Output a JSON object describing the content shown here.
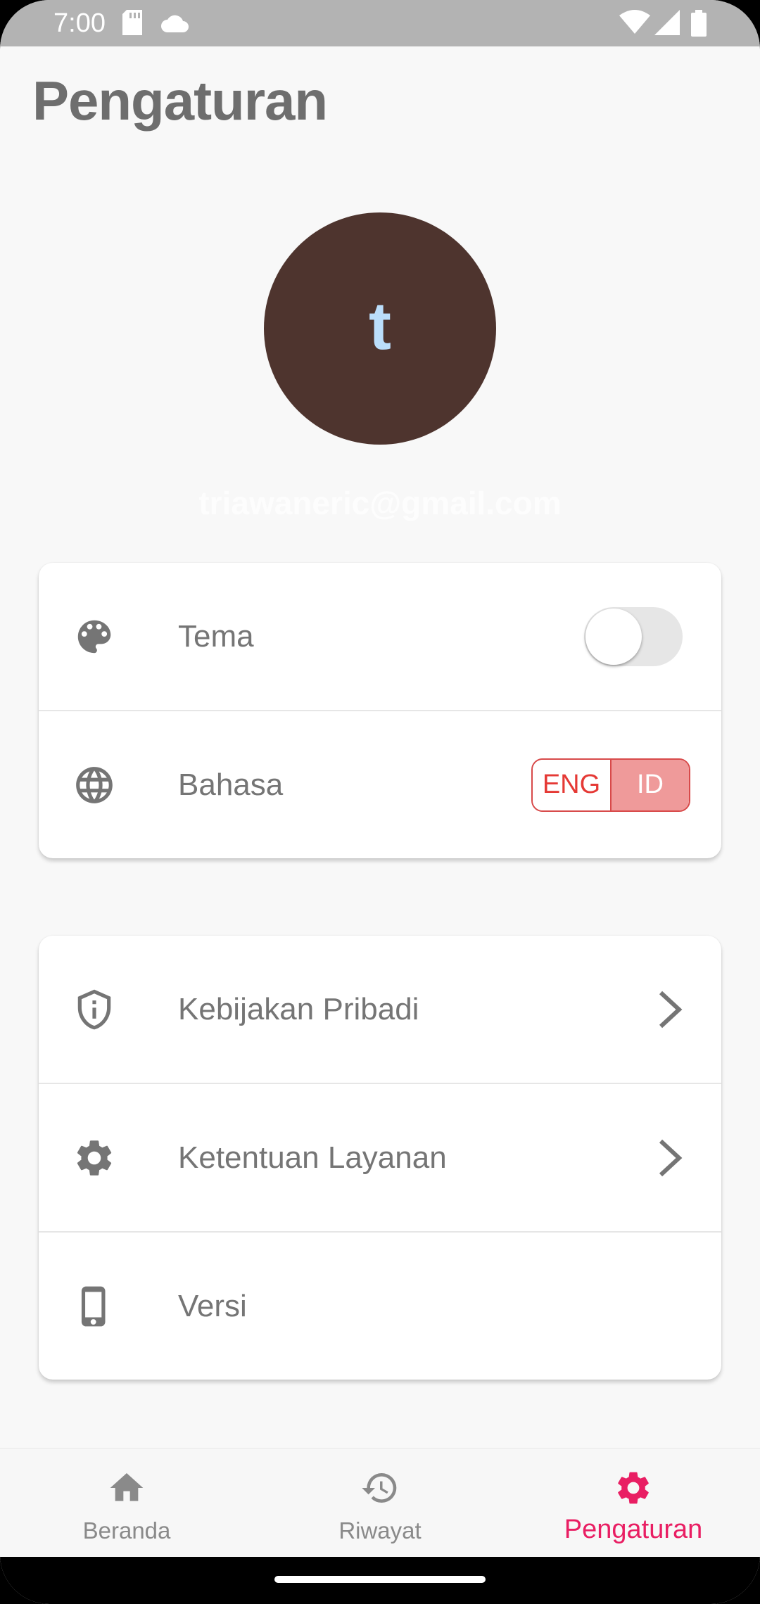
{
  "status_bar": {
    "time": "7:00",
    "icons": [
      "sd-card-icon",
      "cloud-icon",
      "wifi-icon",
      "signal-icon",
      "battery-icon"
    ]
  },
  "page": {
    "title": "Pengaturan"
  },
  "profile": {
    "avatar_letter": "t",
    "avatar_color": "#4e342e",
    "avatar_text_color": "#bbdefb",
    "email": "triawaneric@gmail.com"
  },
  "settings_card": {
    "rows": [
      {
        "label": "Tema",
        "icon": "palette-icon",
        "control": "toggle",
        "toggle_on": false
      },
      {
        "label": "Bahasa",
        "icon": "globe-icon",
        "control": "language-selector"
      }
    ],
    "language": {
      "options": [
        "ENG",
        "ID"
      ],
      "selected": "ID"
    }
  },
  "info_card": {
    "rows": [
      {
        "label": "Kebijakan Pribadi",
        "icon": "shield-info-icon",
        "chevron": true
      },
      {
        "label": "Ketentuan Layanan",
        "icon": "gear-icon",
        "chevron": true
      },
      {
        "label": "Versi",
        "icon": "phone-icon",
        "chevron": false
      }
    ]
  },
  "bottom_nav": {
    "items": [
      {
        "label": "Beranda",
        "icon": "home-icon",
        "active": false
      },
      {
        "label": "Riwayat",
        "icon": "history-icon",
        "active": false
      },
      {
        "label": "Pengaturan",
        "icon": "settings-gear-icon",
        "active": true
      }
    ],
    "active_color": "#e91e63",
    "inactive_color": "#8a8a8a"
  }
}
